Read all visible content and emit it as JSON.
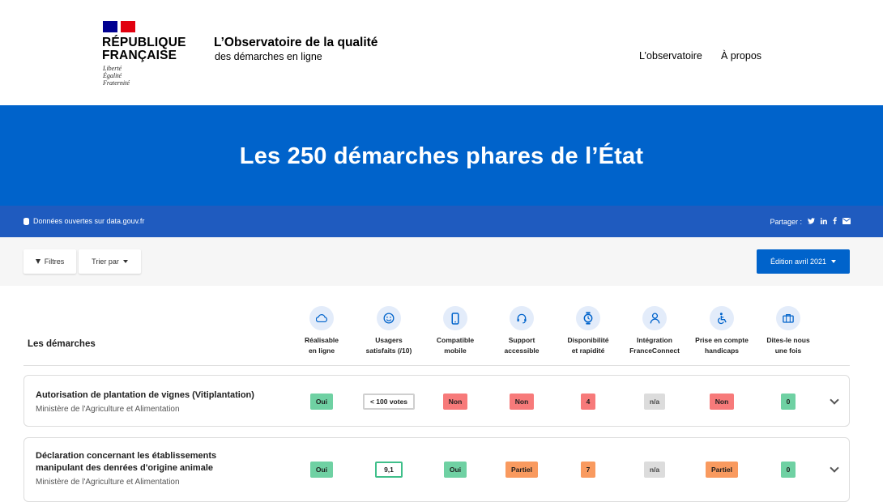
{
  "header": {
    "rf_line1": "RÉPUBLIQUE",
    "rf_line2": "FRANÇAISE",
    "motto": [
      "Liberté",
      "Égalité",
      "Fraternité"
    ],
    "site_title": "L’Observatoire de la qualité",
    "site_subtitle": "des démarches en ligne",
    "nav": [
      "L’observatoire",
      "À propos"
    ]
  },
  "hero": {
    "title": "Les 250 démarches phares de l’État"
  },
  "infobar": {
    "open_data": "Données ouvertes sur data.gouv.fr",
    "share_label": "Partager :",
    "share_icons": [
      "twitter-icon",
      "linkedin-icon",
      "facebook-icon",
      "mail-icon"
    ]
  },
  "toolbar": {
    "filters_label": "Filtres",
    "sort_label": "Trier par",
    "edition_label": "Édition avril 2021"
  },
  "table": {
    "title": "Les démarches",
    "columns": [
      {
        "l1": "Réalisable",
        "l2": "en ligne",
        "icon": "cloud-icon"
      },
      {
        "l1": "Usagers",
        "l2": "satisfaits (/10)",
        "icon": "smiley-icon"
      },
      {
        "l1": "Compatible",
        "l2": "mobile",
        "icon": "mobile-icon"
      },
      {
        "l1": "Support",
        "l2": "accessible",
        "icon": "headset-icon"
      },
      {
        "l1": "Disponibilité",
        "l2": "et rapidité",
        "icon": "stopwatch-icon"
      },
      {
        "l1": "Intégration",
        "l2": "FranceConnect",
        "icon": "user-icon"
      },
      {
        "l1": "Prise en compte",
        "l2": "handicaps",
        "icon": "accessibility-icon"
      },
      {
        "l1": "Dites-le nous",
        "l2": "une fois",
        "icon": "briefcase-icon"
      }
    ],
    "rows": [
      {
        "title_l1": "Autorisation de plantation de vignes (Vitiplantation)",
        "title_l2": "",
        "ministry": "Ministère de l'Agriculture et Alimentation",
        "values": [
          "Oui",
          "< 100 votes",
          "Non",
          "Non",
          "4",
          "n/a",
          "Non",
          "0"
        ],
        "colors": [
          "green",
          "votes",
          "red",
          "red",
          "red",
          "gray",
          "red",
          "green"
        ]
      },
      {
        "title_l1": "Déclaration concernant les établissements",
        "title_l2": "manipulant des denrées d'origine animale",
        "ministry": "Ministère de l'Agriculture et Alimentation",
        "values": [
          "Oui",
          "9,1",
          "Oui",
          "Partiel",
          "7",
          "n/a",
          "Partiel",
          "0"
        ],
        "colors": [
          "green",
          "score",
          "green",
          "orange",
          "orange",
          "gray",
          "orange",
          "green"
        ]
      }
    ]
  }
}
